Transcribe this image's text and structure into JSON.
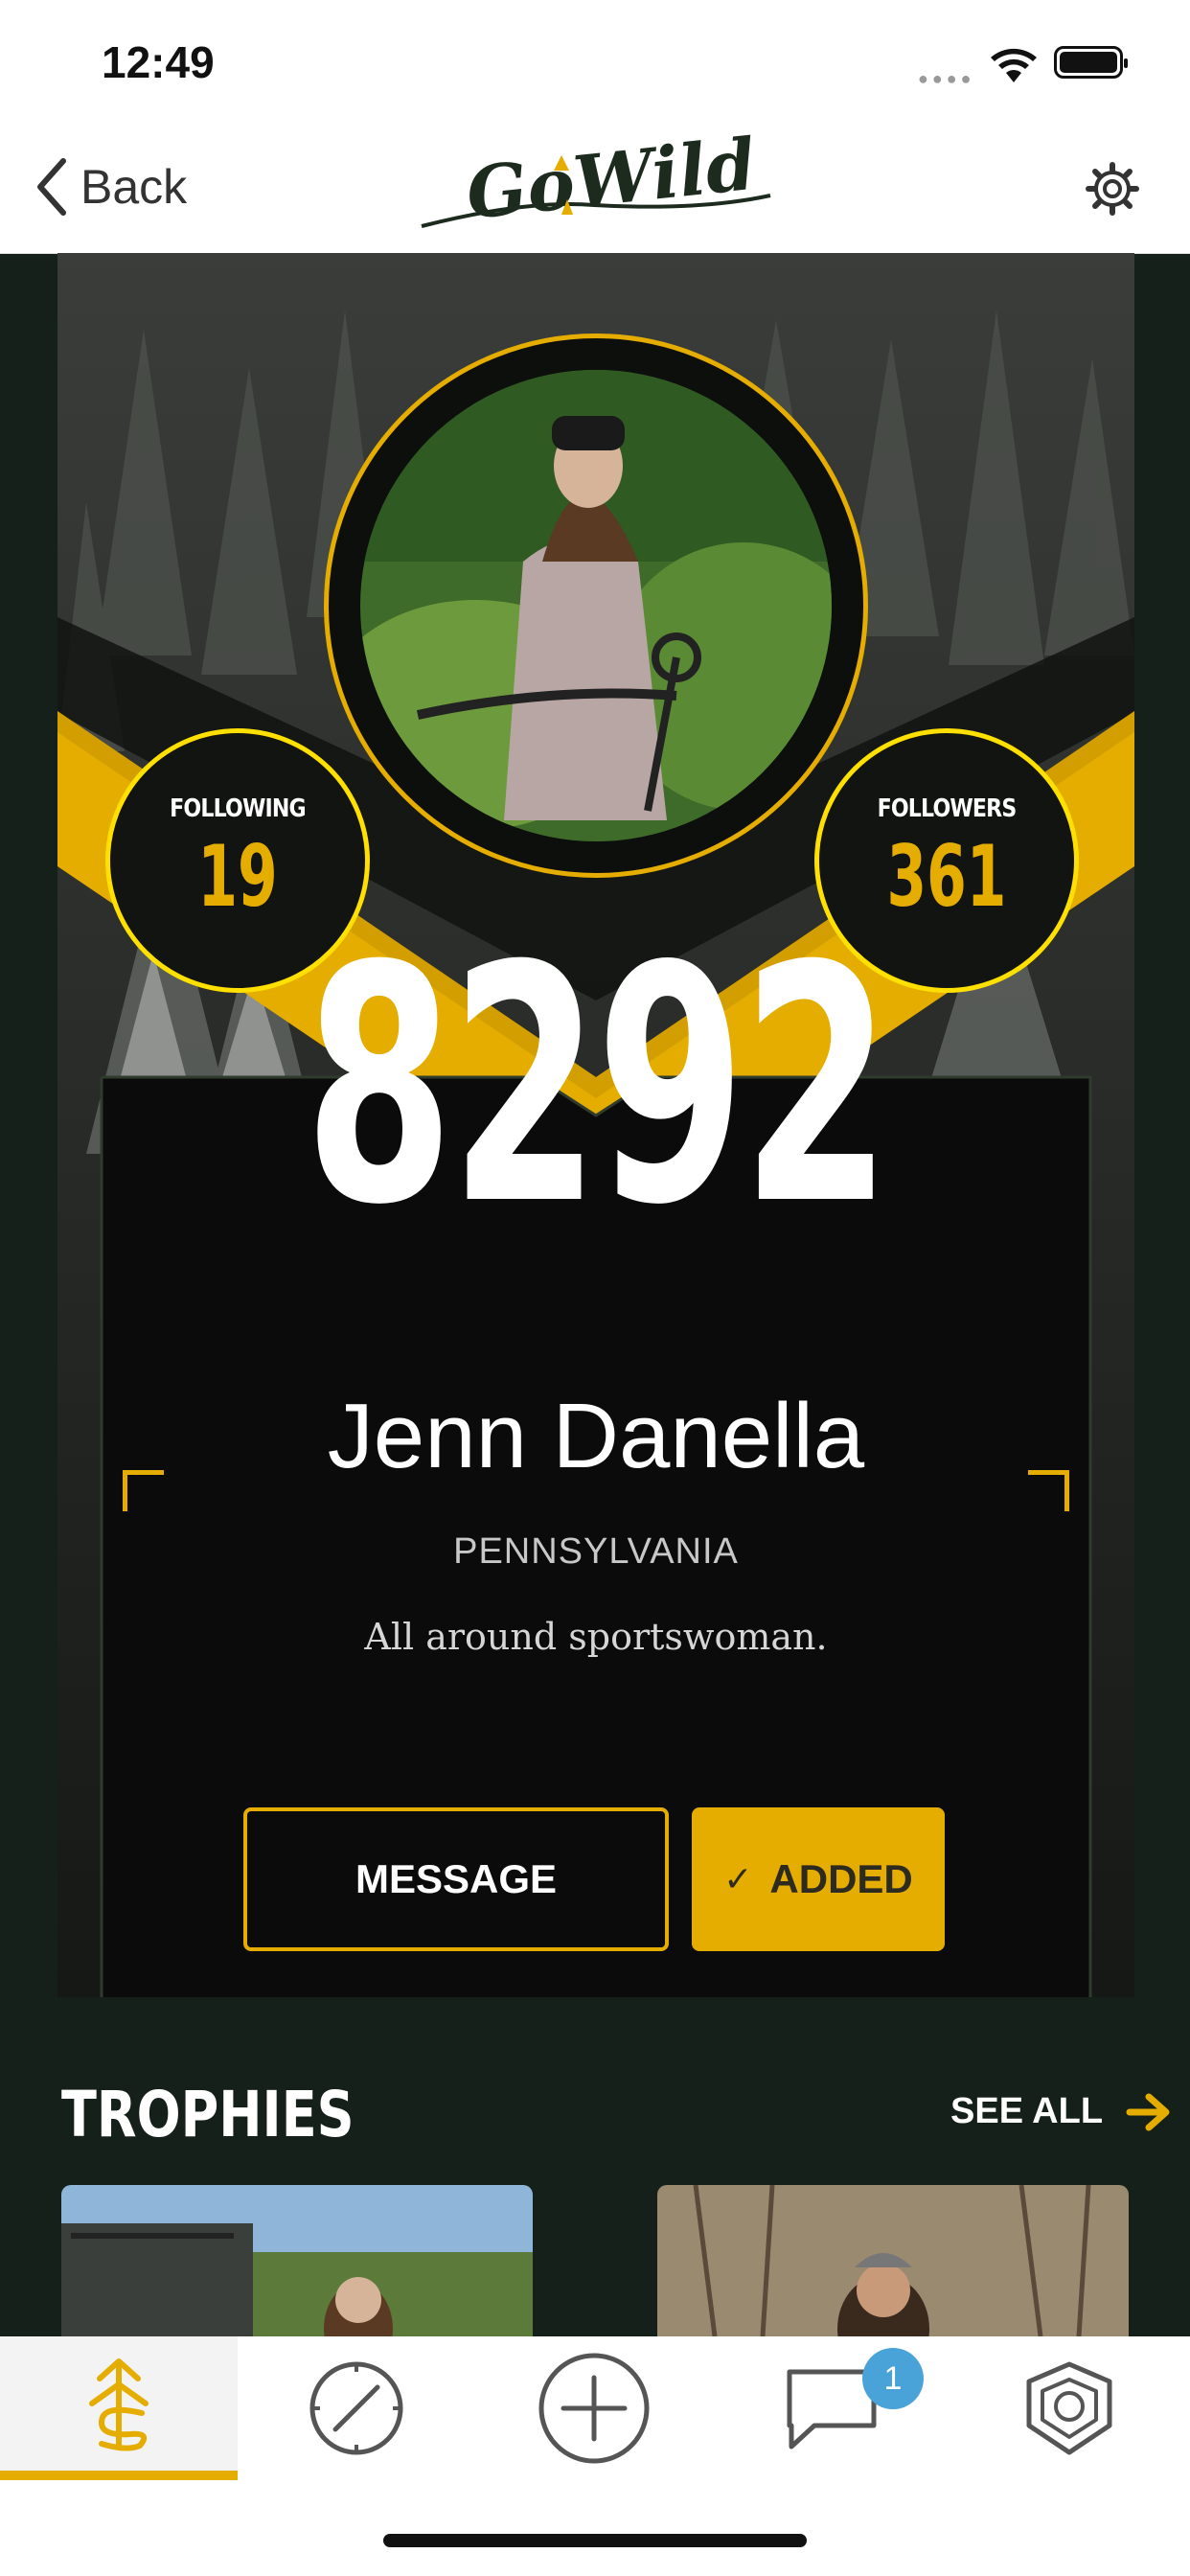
{
  "status_bar": {
    "time": "12:49"
  },
  "nav": {
    "back_label": "Back",
    "logo_text": "GoWild"
  },
  "profile": {
    "following_label": "FOLLOWING",
    "following_count": "19",
    "followers_label": "FOLLOWERS",
    "followers_count": "361",
    "score": "8292",
    "name": "Jenn Danella",
    "location": "PENNSYLVANIA",
    "bio": "All around sportswoman."
  },
  "actions": {
    "message_label": "MESSAGE",
    "added_label": "ADDED"
  },
  "trophies": {
    "title": "TROPHIES",
    "see_all_label": "SEE ALL"
  },
  "tab_bar": {
    "items": [
      "home-icon",
      "compass-icon",
      "add-icon",
      "chat-icon",
      "badge-icon"
    ],
    "chat_badge": "1"
  },
  "colors": {
    "accent": "#e5ad00",
    "background": "#16201a",
    "badge": "#4aa3d8"
  }
}
